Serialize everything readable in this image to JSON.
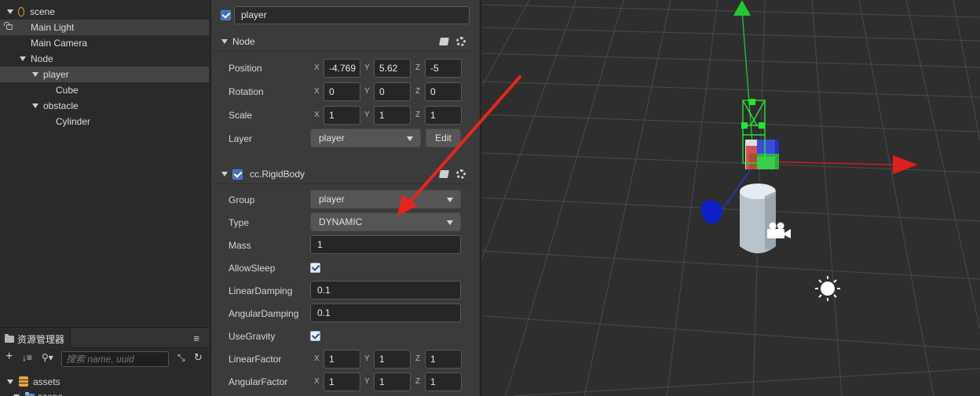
{
  "hierarchy": {
    "items": [
      {
        "label": "scene"
      },
      {
        "label": "Main Light"
      },
      {
        "label": "Main Camera"
      },
      {
        "label": "Node"
      },
      {
        "label": "player"
      },
      {
        "label": "Cube"
      },
      {
        "label": "obstacle"
      },
      {
        "label": "Cylinder"
      }
    ]
  },
  "assets": {
    "tab_label": "资源管理器",
    "search_placeholder": "搜索 name, uuid",
    "root_label": "assets",
    "partial_child_label": "scene"
  },
  "inspector": {
    "node_active": true,
    "node_name": "player",
    "node_section": {
      "title": "Node",
      "position": {
        "label": "Position",
        "x": "-4.769",
        "y": "5.62",
        "z": "-5"
      },
      "rotation": {
        "label": "Rotation",
        "x": "0",
        "y": "0",
        "z": "0"
      },
      "scale": {
        "label": "Scale",
        "x": "1",
        "y": "1",
        "z": "1"
      },
      "layer": {
        "label": "Layer",
        "value": "player",
        "edit_label": "Edit"
      }
    },
    "rigidbody_section": {
      "title": "cc.RigidBody",
      "enabled": true,
      "group": {
        "label": "Group",
        "value": "player"
      },
      "type": {
        "label": "Type",
        "value": "DYNAMIC"
      },
      "mass": {
        "label": "Mass",
        "value": "1"
      },
      "allow_sleep": {
        "label": "AllowSleep",
        "checked": true
      },
      "linear_damping": {
        "label": "LinearDamping",
        "value": "0.1"
      },
      "angular_damping": {
        "label": "AngularDamping",
        "value": "0.1"
      },
      "use_gravity": {
        "label": "UseGravity",
        "checked": true
      },
      "linear_factor": {
        "label": "LinearFactor",
        "x": "1",
        "y": "1",
        "z": "1"
      },
      "angular_factor": {
        "label": "AngularFactor",
        "x": "1",
        "y": "1",
        "z": "1"
      }
    },
    "axis_labels": {
      "x": "X",
      "y": "Y",
      "z": "Z"
    }
  },
  "colors": {
    "accent_blue": "#3f6fc0",
    "gizmo_x": "#e01e1e",
    "gizmo_y": "#22c832",
    "gizmo_z": "#1e3fe0",
    "annotation_arrow": "#e8241e"
  },
  "icons": [
    "scene-icon",
    "lock-icon",
    "folder-icon",
    "database-icon",
    "book-icon",
    "gear-icon",
    "camera-icon",
    "sun-icon",
    "search-icon",
    "plus-icon",
    "sort-icon",
    "refresh-icon",
    "collapse-icon",
    "menu-icon"
  ]
}
